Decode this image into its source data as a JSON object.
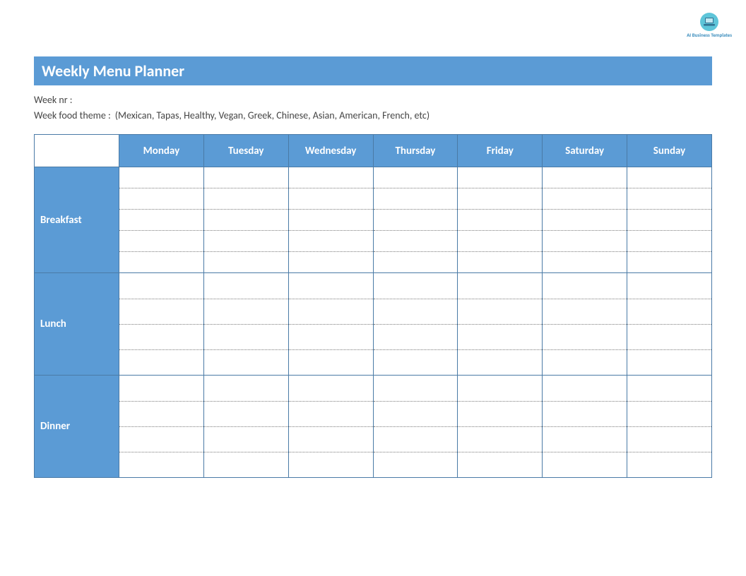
{
  "logo": {
    "label": "AI Business Templates",
    "icon": "laptop-icon"
  },
  "header": {
    "title": "Weekly Menu Planner"
  },
  "meta": {
    "week_nr_label": "Week nr :",
    "week_nr_value": "",
    "theme_label": "Week food theme :",
    "theme_value": "(Mexican, Tapas, Healthy, Vegan, Greek, Chinese, Asian, American, French, etc)"
  },
  "table": {
    "days": [
      "Monday",
      "Tuesday",
      "Wednesday",
      "Thursday",
      "Friday",
      "Saturday",
      "Sunday"
    ],
    "meals": [
      "Breakfast",
      "Lunch",
      "Dinner"
    ],
    "lines_per_cell": [
      5,
      4,
      4
    ],
    "cells": {
      "Breakfast": {
        "Monday": [
          "",
          "",
          "",
          "",
          ""
        ],
        "Tuesday": [
          "",
          "",
          "",
          "",
          ""
        ],
        "Wednesday": [
          "",
          "",
          "",
          "",
          ""
        ],
        "Thursday": [
          "",
          "",
          "",
          "",
          ""
        ],
        "Friday": [
          "",
          "",
          "",
          "",
          ""
        ],
        "Saturday": [
          "",
          "",
          "",
          "",
          ""
        ],
        "Sunday": [
          "",
          "",
          "",
          "",
          ""
        ]
      },
      "Lunch": {
        "Monday": [
          "",
          "",
          "",
          ""
        ],
        "Tuesday": [
          "",
          "",
          "",
          ""
        ],
        "Wednesday": [
          "",
          "",
          "",
          ""
        ],
        "Thursday": [
          "",
          "",
          "",
          ""
        ],
        "Friday": [
          "",
          "",
          "",
          ""
        ],
        "Saturday": [
          "",
          "",
          "",
          ""
        ],
        "Sunday": [
          "",
          "",
          "",
          ""
        ]
      },
      "Dinner": {
        "Monday": [
          "",
          "",
          "",
          ""
        ],
        "Tuesday": [
          "",
          "",
          "",
          ""
        ],
        "Wednesday": [
          "",
          "",
          "",
          ""
        ],
        "Thursday": [
          "",
          "",
          "",
          ""
        ],
        "Friday": [
          "",
          "",
          "",
          ""
        ],
        "Saturday": [
          "",
          "",
          "",
          ""
        ],
        "Sunday": [
          "",
          "",
          "",
          ""
        ]
      }
    }
  },
  "colors": {
    "primary": "#5b9bd5",
    "border": "#4a7aa6"
  }
}
